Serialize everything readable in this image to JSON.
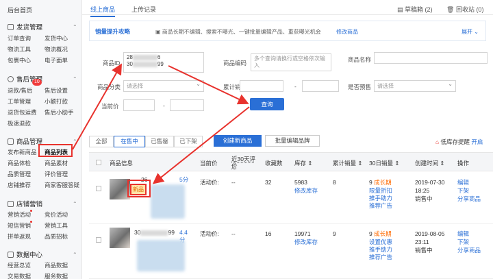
{
  "sidebar": {
    "home": "后台首页",
    "sections": [
      {
        "title": "发货管理",
        "items": [
          "订单查询",
          "发货中心",
          "物流工具",
          "物流概况",
          "包裹中心",
          "电子面单"
        ]
      },
      {
        "title": "售后管理",
        "badge": "10",
        "items": [
          "退款/售后",
          "售后设置",
          "工单管理",
          "小额打款",
          "退货包运费",
          "售后小助手",
          "极速退款"
        ]
      },
      {
        "title": "商品管理",
        "items": [
          "发布新商品",
          "商品列表",
          "商品体检",
          "商品素材",
          "品质管理",
          "评价管理",
          "店铺推荐",
          "商家客服答疑"
        ]
      },
      {
        "title": "店铺营销",
        "items": [
          "营销活动",
          "竞价活动",
          "短信营销",
          "营销工具",
          "拼单返现",
          "品质招标"
        ]
      },
      {
        "title": "数据中心",
        "items": [
          "经营总览",
          "商品数据",
          "交易数据",
          "服务数据"
        ]
      }
    ]
  },
  "tabs": {
    "online": "线上商品",
    "upload": "上传记录",
    "draft": "草稿箱 (2)",
    "recycle": "回收站 (0)"
  },
  "banner": {
    "title": "销量提升攻略",
    "text": "商品长期不编辑、搜索不曝光、一键批量编辑产品、重获曝光机会",
    "link": "修改商品",
    "expand": "展开"
  },
  "filters": {
    "id_label": "商品ID",
    "id_value_1": "28",
    "id_value_1_end": "6",
    "id_value_2": "30",
    "id_value_2_end": "99",
    "code_label": "商品编码",
    "code_placeholder": "多个查询请换行或空格依次输入",
    "name_label": "商品名称",
    "category_label": "商品分类",
    "category_placeholder": "请选择",
    "sales_label": "累计销量",
    "presale_label": "是否预售",
    "presale_placeholder": "请选择",
    "price_label": "当前价",
    "range_sep": "-",
    "query_button": "查询"
  },
  "status_tabs": [
    "全部",
    "在售中",
    "已售罄",
    "已下架"
  ],
  "actions": {
    "create": "创建新商品",
    "batch": "批量编辑品牌",
    "low_stock": "低库存提醒",
    "open": "开启"
  },
  "table": {
    "headers": [
      "商品信息",
      "当前价",
      "近30天评价",
      "收藏数",
      "库存 ⇕",
      "累计销量 ⇕",
      "30日销量 ⇕",
      "创建时间 ⇕",
      "操作"
    ],
    "rows": [
      {
        "id_prefix": "26",
        "tag": "新品",
        "score": "5分",
        "price_label": "活动价:",
        "reviews": "--",
        "fav": "32",
        "stock": "5983",
        "stock_link": "修改库存",
        "sales": "8",
        "sales30": "9",
        "growth": "成长期",
        "promo": [
          "限量折扣",
          "推手助力",
          "推荐广告"
        ],
        "date": "2019-07-30",
        "time": "18:25",
        "status": "销售中",
        "ops": [
          "编辑",
          "下架",
          "分享商品"
        ]
      },
      {
        "id_prefix": "30",
        "id_suffix": "99",
        "score": "4.4分",
        "price_label": "活动价:",
        "reviews": "--",
        "fav": "16",
        "stock": "19971",
        "stock_link": "修改库存",
        "sales": "9",
        "sales30": "9",
        "growth": "成长期",
        "promo": [
          "设置优惠",
          "推手助力",
          "推荐广告"
        ],
        "date": "2019-08-05",
        "time": "23:11",
        "status": "销售中",
        "ops": [
          "编辑",
          "下架",
          "分享商品"
        ]
      }
    ]
  },
  "colors": {
    "accent": "#2a6fd6",
    "highlight": "#e8322d",
    "orange": "#ff6a00"
  }
}
